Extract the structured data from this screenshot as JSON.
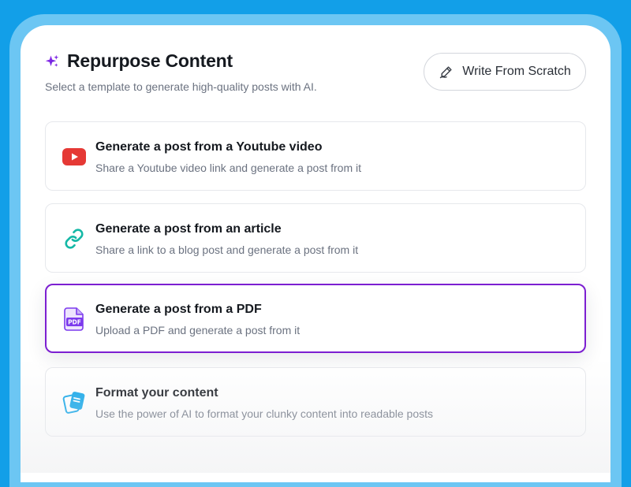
{
  "header": {
    "title": "Repurpose Content",
    "subtitle": "Select a template to generate high-quality posts with AI.",
    "title_icon": "sparkles-icon",
    "scratch_button_label": "Write From Scratch",
    "scratch_button_icon": "pen-icon"
  },
  "colors": {
    "background": "#129fe8",
    "frame": "#6cc6f3",
    "accent_purple": "#7c1fd1",
    "youtube_red": "#e53935",
    "link_green": "#14b8a6",
    "pdf_purple": "#7c3aed",
    "format_blue": "#0ea5e9"
  },
  "options": [
    {
      "title": "Generate a post from a Youtube video",
      "description": "Share a Youtube video link and generate a post from it",
      "icon": "youtube-icon",
      "selected": false
    },
    {
      "title": "Generate a post from an article",
      "description": "Share a link to a blog post and generate a post from it",
      "icon": "link-icon",
      "selected": false
    },
    {
      "title": "Generate a post from a PDF",
      "description": "Upload a PDF and generate a post from it",
      "icon": "pdf-icon",
      "selected": true
    },
    {
      "title": "Format your content",
      "description": "Use the power of AI to format your clunky content into readable posts",
      "icon": "documents-icon",
      "selected": false
    }
  ]
}
